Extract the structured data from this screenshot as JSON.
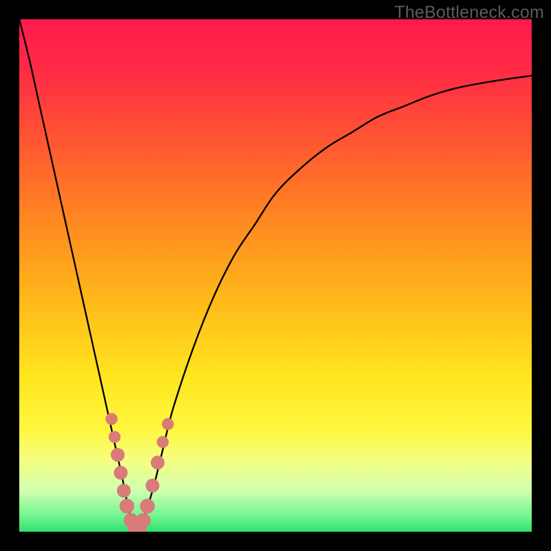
{
  "watermark": "TheBottleneck.com",
  "gradient": {
    "stops": [
      {
        "offset": 0.0,
        "color": "#ff1a4d"
      },
      {
        "offset": 0.1,
        "color": "#ff2b45"
      },
      {
        "offset": 0.25,
        "color": "#ff5a30"
      },
      {
        "offset": 0.4,
        "color": "#ff8a20"
      },
      {
        "offset": 0.55,
        "color": "#ffb91a"
      },
      {
        "offset": 0.7,
        "color": "#ffe61f"
      },
      {
        "offset": 0.8,
        "color": "#fff73f"
      },
      {
        "offset": 0.86,
        "color": "#f5ff80"
      },
      {
        "offset": 0.92,
        "color": "#d0ffb0"
      },
      {
        "offset": 0.97,
        "color": "#70f590"
      },
      {
        "offset": 1.0,
        "color": "#2ee070"
      }
    ]
  },
  "chart_data": {
    "type": "line",
    "title": "",
    "xlabel": "",
    "ylabel": "",
    "xlim": [
      0,
      100
    ],
    "ylim": [
      0,
      100
    ],
    "grid": false,
    "series": [
      {
        "name": "bottleneck-curve",
        "x": [
          0,
          2,
          4,
          6,
          8,
          10,
          12,
          14,
          16,
          18,
          20,
          21,
          22,
          23,
          24,
          26,
          28,
          30,
          34,
          38,
          42,
          46,
          50,
          55,
          60,
          65,
          70,
          75,
          80,
          85,
          90,
          95,
          100
        ],
        "y": [
          100,
          92,
          83,
          74,
          65,
          56,
          47,
          38,
          29,
          20,
          11,
          6,
          2,
          0,
          2,
          8,
          16,
          24,
          36,
          46,
          54,
          60,
          66,
          71,
          75,
          78,
          81,
          83,
          85,
          86.5,
          87.5,
          88.3,
          89
        ]
      }
    ],
    "markers": {
      "name": "highlight-dots",
      "color": "#d97b78",
      "points": [
        {
          "x": 18.0,
          "y": 22.0,
          "r": 1.3
        },
        {
          "x": 18.6,
          "y": 18.5,
          "r": 1.3
        },
        {
          "x": 19.2,
          "y": 15.0,
          "r": 1.5
        },
        {
          "x": 19.8,
          "y": 11.5,
          "r": 1.5
        },
        {
          "x": 20.4,
          "y": 8.0,
          "r": 1.5
        },
        {
          "x": 21.0,
          "y": 5.0,
          "r": 1.6
        },
        {
          "x": 21.8,
          "y": 2.2,
          "r": 1.6
        },
        {
          "x": 22.6,
          "y": 0.6,
          "r": 1.6
        },
        {
          "x": 23.4,
          "y": 0.6,
          "r": 1.6
        },
        {
          "x": 24.2,
          "y": 2.2,
          "r": 1.6
        },
        {
          "x": 25.0,
          "y": 5.0,
          "r": 1.6
        },
        {
          "x": 26.0,
          "y": 9.0,
          "r": 1.5
        },
        {
          "x": 27.0,
          "y": 13.5,
          "r": 1.5
        },
        {
          "x": 28.0,
          "y": 17.5,
          "r": 1.3
        },
        {
          "x": 29.0,
          "y": 21.0,
          "r": 1.3
        }
      ]
    }
  }
}
